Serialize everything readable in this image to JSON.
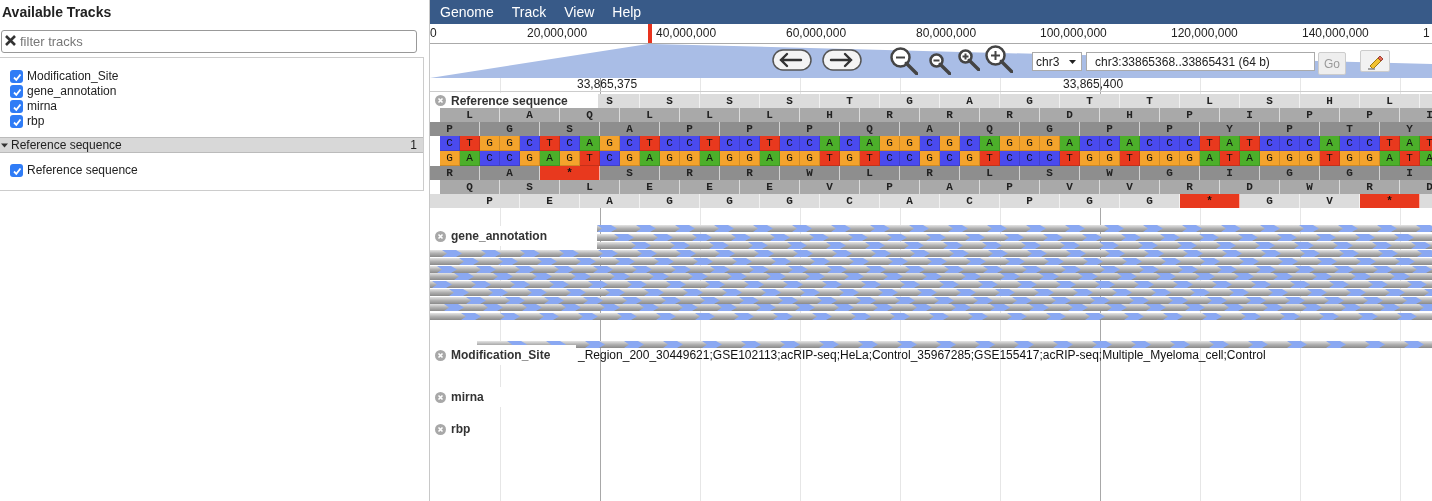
{
  "left_panel": {
    "title": "Available Tracks",
    "filter": {
      "placeholder": "filter tracks"
    },
    "tracks": [
      {
        "label": "Modification_Site",
        "checked": true
      },
      {
        "label": "gene_annotation",
        "checked": true
      },
      {
        "label": "mirna",
        "checked": true
      },
      {
        "label": "rbp",
        "checked": true
      }
    ],
    "categories": [
      {
        "label": "Reference sequence",
        "count": "1",
        "expanded": true,
        "tracks": [
          {
            "label": "Reference sequence",
            "checked": true
          }
        ]
      }
    ]
  },
  "menu": [
    "Genome",
    "Track",
    "View",
    "Help"
  ],
  "overview": {
    "labels": [
      "0",
      "20,000,000",
      "40,000,000",
      "60,000,000",
      "80,000,000",
      "100,000,000",
      "120,000,000",
      "140,000,000",
      "1"
    ]
  },
  "navigation": {
    "chromosome": "chr3",
    "location": "chr3:33865368..33865431 (64 b)",
    "go": "Go",
    "go_disabled": true
  },
  "ruler": [
    "33,865,375",
    "33,865,400"
  ],
  "tracks": [
    {
      "kind": "sequence",
      "label": "Reference sequence",
      "forward_frames": [
        {
          "cells": [
            "S",
            "S",
            "S",
            "S",
            "T",
            "G",
            "A",
            "G",
            "T",
            "T",
            "L",
            "S",
            "H",
            "L"
          ]
        },
        {
          "cells": [
            "L",
            "A",
            "Q",
            "L",
            "L",
            "L",
            "H",
            "R",
            "R",
            "R",
            "D",
            "H",
            "P",
            "I",
            "P",
            "P",
            "I"
          ]
        },
        {
          "cells": [
            "P",
            "G",
            "S",
            "A",
            "P",
            "P",
            "P",
            "Q",
            "A",
            "Q",
            "G",
            "P",
            "P",
            "Y",
            "P",
            "T",
            "Y"
          ]
        }
      ],
      "forward": [
        {
          "base": "C",
          "color": "#4a4aee"
        },
        {
          "base": "T",
          "color": "#e8391e"
        },
        {
          "base": "G",
          "color": "#f4a32c"
        },
        {
          "base": "G",
          "color": "#f4a32c"
        },
        {
          "base": "C",
          "color": "#4a4aee"
        },
        {
          "base": "T",
          "color": "#e8391e"
        },
        {
          "base": "C",
          "color": "#4a4aee"
        },
        {
          "base": "A",
          "color": "#4caf2a"
        },
        {
          "base": "G",
          "color": "#f4a32c"
        },
        {
          "base": "C",
          "color": "#4a4aee"
        },
        {
          "base": "T",
          "color": "#e8391e"
        },
        {
          "base": "C",
          "color": "#4a4aee"
        },
        {
          "base": "C",
          "color": "#4a4aee"
        },
        {
          "base": "T",
          "color": "#e8391e"
        },
        {
          "base": "C",
          "color": "#4a4aee"
        },
        {
          "base": "C",
          "color": "#4a4aee"
        },
        {
          "base": "T",
          "color": "#e8391e"
        },
        {
          "base": "C",
          "color": "#4a4aee"
        },
        {
          "base": "C",
          "color": "#4a4aee"
        },
        {
          "base": "A",
          "color": "#4caf2a"
        },
        {
          "base": "C",
          "color": "#4a4aee"
        },
        {
          "base": "A",
          "color": "#4caf2a"
        },
        {
          "base": "G",
          "color": "#f4a32c"
        },
        {
          "base": "G",
          "color": "#f4a32c"
        },
        {
          "base": "C",
          "color": "#4a4aee"
        },
        {
          "base": "G",
          "color": "#f4a32c"
        },
        {
          "base": "C",
          "color": "#4a4aee"
        },
        {
          "base": "A",
          "color": "#4caf2a"
        },
        {
          "base": "G",
          "color": "#f4a32c"
        },
        {
          "base": "G",
          "color": "#f4a32c"
        },
        {
          "base": "G",
          "color": "#f4a32c"
        },
        {
          "base": "A",
          "color": "#4caf2a"
        },
        {
          "base": "C",
          "color": "#4a4aee"
        },
        {
          "base": "C",
          "color": "#4a4aee"
        },
        {
          "base": "A",
          "color": "#4caf2a"
        },
        {
          "base": "C",
          "color": "#4a4aee"
        },
        {
          "base": "C",
          "color": "#4a4aee"
        },
        {
          "base": "C",
          "color": "#4a4aee"
        },
        {
          "base": "T",
          "color": "#e8391e"
        },
        {
          "base": "A",
          "color": "#4caf2a"
        },
        {
          "base": "T",
          "color": "#e8391e"
        },
        {
          "base": "C",
          "color": "#4a4aee"
        },
        {
          "base": "C",
          "color": "#4a4aee"
        },
        {
          "base": "C",
          "color": "#4a4aee"
        },
        {
          "base": "A",
          "color": "#4caf2a"
        },
        {
          "base": "C",
          "color": "#4a4aee"
        },
        {
          "base": "C",
          "color": "#4a4aee"
        },
        {
          "base": "T",
          "color": "#e8391e"
        },
        {
          "base": "A",
          "color": "#4caf2a"
        },
        {
          "base": "T",
          "color": "#e8391e"
        }
      ],
      "reverse": [
        {
          "base": "G",
          "color": "#f4a32c"
        },
        {
          "base": "A",
          "color": "#4caf2a"
        },
        {
          "base": "C",
          "color": "#4a4aee"
        },
        {
          "base": "C",
          "color": "#4a4aee"
        },
        {
          "base": "G",
          "color": "#f4a32c"
        },
        {
          "base": "A",
          "color": "#4caf2a"
        },
        {
          "base": "G",
          "color": "#f4a32c"
        },
        {
          "base": "T",
          "color": "#e8391e"
        },
        {
          "base": "C",
          "color": "#4a4aee"
        },
        {
          "base": "G",
          "color": "#f4a32c"
        },
        {
          "base": "A",
          "color": "#4caf2a"
        },
        {
          "base": "G",
          "color": "#f4a32c"
        },
        {
          "base": "G",
          "color": "#f4a32c"
        },
        {
          "base": "A",
          "color": "#4caf2a"
        },
        {
          "base": "G",
          "color": "#f4a32c"
        },
        {
          "base": "G",
          "color": "#f4a32c"
        },
        {
          "base": "A",
          "color": "#4caf2a"
        },
        {
          "base": "G",
          "color": "#f4a32c"
        },
        {
          "base": "G",
          "color": "#f4a32c"
        },
        {
          "base": "T",
          "color": "#e8391e"
        },
        {
          "base": "G",
          "color": "#f4a32c"
        },
        {
          "base": "T",
          "color": "#e8391e"
        },
        {
          "base": "C",
          "color": "#4a4aee"
        },
        {
          "base": "C",
          "color": "#4a4aee"
        },
        {
          "base": "G",
          "color": "#f4a32c"
        },
        {
          "base": "C",
          "color": "#4a4aee"
        },
        {
          "base": "G",
          "color": "#f4a32c"
        },
        {
          "base": "T",
          "color": "#e8391e"
        },
        {
          "base": "C",
          "color": "#4a4aee"
        },
        {
          "base": "C",
          "color": "#4a4aee"
        },
        {
          "base": "C",
          "color": "#4a4aee"
        },
        {
          "base": "T",
          "color": "#e8391e"
        },
        {
          "base": "G",
          "color": "#f4a32c"
        },
        {
          "base": "G",
          "color": "#f4a32c"
        },
        {
          "base": "T",
          "color": "#e8391e"
        },
        {
          "base": "G",
          "color": "#f4a32c"
        },
        {
          "base": "G",
          "color": "#f4a32c"
        },
        {
          "base": "G",
          "color": "#f4a32c"
        },
        {
          "base": "A",
          "color": "#4caf2a"
        },
        {
          "base": "T",
          "color": "#e8391e"
        },
        {
          "base": "A",
          "color": "#4caf2a"
        },
        {
          "base": "G",
          "color": "#f4a32c"
        },
        {
          "base": "G",
          "color": "#f4a32c"
        },
        {
          "base": "G",
          "color": "#f4a32c"
        },
        {
          "base": "T",
          "color": "#e8391e"
        },
        {
          "base": "G",
          "color": "#f4a32c"
        },
        {
          "base": "G",
          "color": "#f4a32c"
        },
        {
          "base": "A",
          "color": "#4caf2a"
        },
        {
          "base": "T",
          "color": "#e8391e"
        },
        {
          "base": "A",
          "color": "#4caf2a"
        }
      ],
      "reverse_frames": [
        {
          "cells": [
            "R",
            "A",
            {
              "text": "*",
              "kind": "stop"
            },
            "S",
            "R",
            "R",
            "W",
            "L",
            "R",
            "L",
            "S",
            "W",
            "G",
            "I",
            "G",
            "G",
            "I"
          ]
        },
        {
          "cells": [
            "Q",
            "S",
            "L",
            "E",
            "E",
            "E",
            "V",
            "P",
            "A",
            "P",
            "V",
            "V",
            "R",
            "D",
            "W",
            "R",
            "D"
          ]
        },
        {
          "cells": [
            "P",
            "E",
            "A",
            "G",
            "G",
            "G",
            "C",
            "A",
            "C",
            "P",
            "G",
            "G",
            {
              "text": "*",
              "kind": "stop"
            },
            "G",
            "V",
            {
              "text": "*",
              "kind": "stop"
            }
          ]
        }
      ]
    },
    {
      "kind": "feature_stack",
      "label": "gene_annotation"
    },
    {
      "kind": "feature",
      "label": "Modification_Site",
      "description": "_Region_200_30449621;GSE102113;acRIP-seq;HeLa;Control_35967285;GSE155417;acRIP-seq;Multiple_Myeloma_cell;Control"
    },
    {
      "kind": "empty",
      "label": "mirna"
    },
    {
      "kind": "empty",
      "label": "rbp"
    }
  ]
}
